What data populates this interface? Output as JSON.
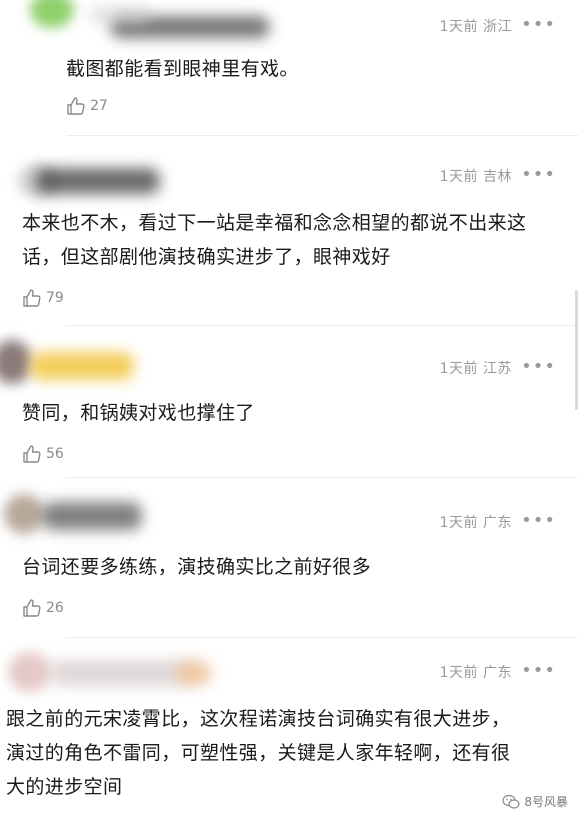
{
  "comments": [
    {
      "time": "1天前",
      "region": "浙江",
      "text": "截图都能看到眼神里有戏。",
      "likes": "27"
    },
    {
      "time": "1天前",
      "region": "吉林",
      "text": "本来也不木，看过下一站是幸福和念念相望的都说不出来这话，但这部剧他演技确实进步了，眼神戏好",
      "likes": "79"
    },
    {
      "time": "1天前",
      "region": "江苏",
      "text": "赞同，和锅姨对戏也撑住了",
      "likes": "56"
    },
    {
      "time": "1天前",
      "region": "广东",
      "text": "台词还要多练练，演技确实比之前好很多",
      "likes": "26"
    },
    {
      "time": "1天前",
      "region": "广东",
      "text": "跟之前的元宋凌霄比，这次程诺演技台词确实有很大进步，演过的角色不雷同，可塑性强，关键是人家年轻啊，还有很大的进步空间",
      "likes": ""
    }
  ],
  "more_icon": "•••",
  "icons": {
    "like": "thumbs-up-icon",
    "more": "more-dots-icon",
    "watermark": "wechat-icon"
  },
  "watermark": "8号风暴",
  "colors": {
    "meta": "#9a9a9a",
    "text": "#1a1a1a",
    "divider": "#ececec"
  }
}
